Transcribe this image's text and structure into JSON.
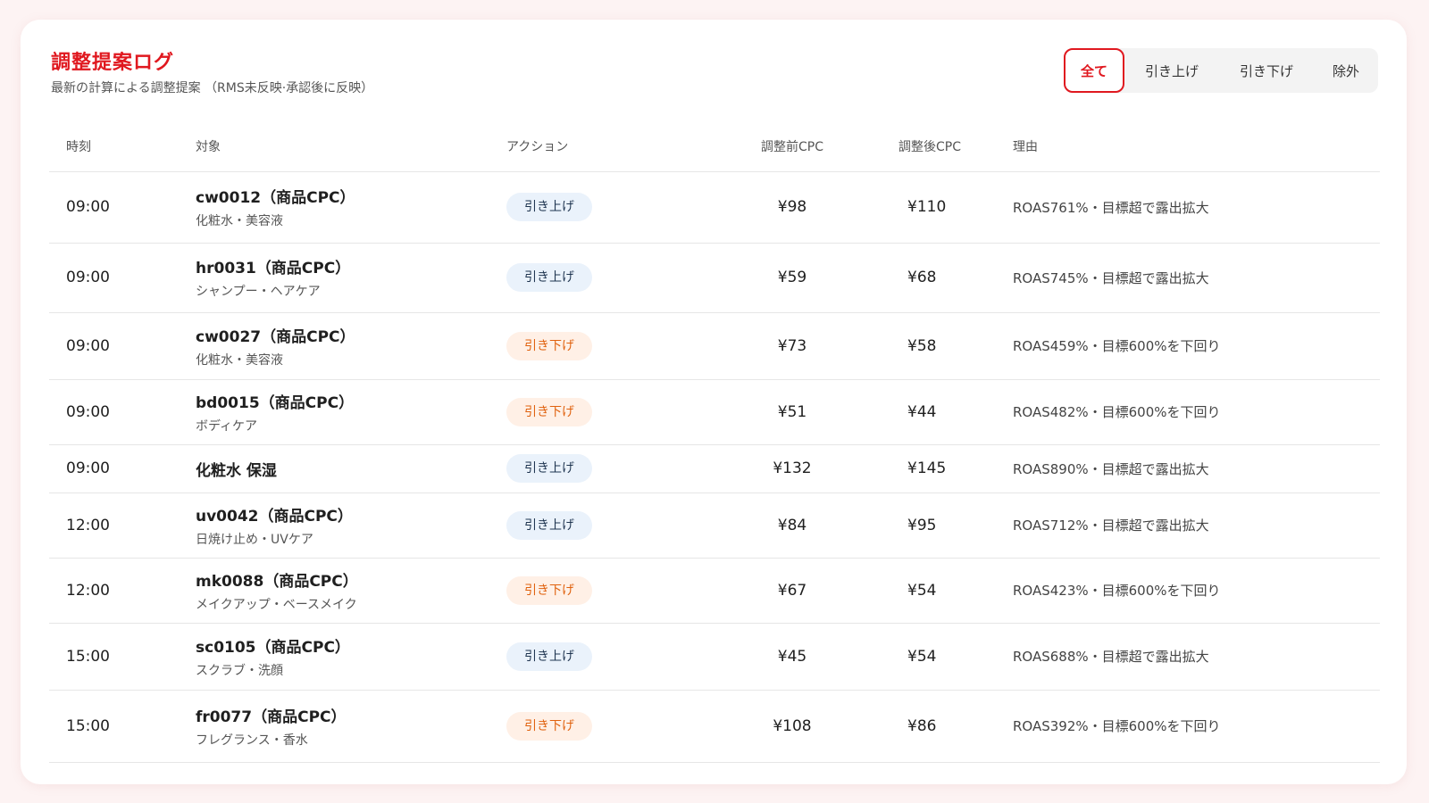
{
  "header": {
    "title": "調整提案ログ",
    "subtitle": "最新の計算による調整提案 （RMS未反映·承認後に反映）"
  },
  "filters": [
    {
      "label": "全て",
      "active": true
    },
    {
      "label": "引き上げ",
      "active": false
    },
    {
      "label": "引き下げ",
      "active": false
    },
    {
      "label": "除外",
      "active": false
    }
  ],
  "table": {
    "columns": {
      "time": "時刻",
      "target": "対象",
      "action": "アクション",
      "before": "調整前CPC",
      "after": "調整後CPC",
      "reason": "理由"
    },
    "rows": [
      {
        "time": "09:00",
        "name": "cw0012（商品CPC）",
        "sub": "化粧水・美容液",
        "action": "引き上げ",
        "type": "up",
        "before": "¥98",
        "after": "¥110",
        "reason": "ROAS761%・目標超で露出拡大"
      },
      {
        "time": "09:00",
        "name": "hr0031（商品CPC）",
        "sub": "シャンプー・ヘアケア",
        "action": "引き上げ",
        "type": "up",
        "before": "¥59",
        "after": "¥68",
        "reason": "ROAS745%・目標超で露出拡大"
      },
      {
        "time": "09:00",
        "name": "cw0027（商品CPC）",
        "sub": "化粧水・美容液",
        "action": "引き下げ",
        "type": "down",
        "before": "¥73",
        "after": "¥58",
        "reason": "ROAS459%・目標600%を下回り"
      },
      {
        "time": "09:00",
        "name": "bd0015（商品CPC）",
        "sub": "ボディケア",
        "action": "引き下げ",
        "type": "down",
        "before": "¥51",
        "after": "¥44",
        "reason": "ROAS482%・目標600%を下回り"
      },
      {
        "time": "09:00",
        "name": "化粧水 保湿",
        "sub": "",
        "action": "引き上げ",
        "type": "up",
        "before": "¥132",
        "after": "¥145",
        "reason": "ROAS890%・目標超で露出拡大"
      },
      {
        "time": "12:00",
        "name": "uv0042（商品CPC）",
        "sub": "日焼け止め・UVケア",
        "action": "引き上げ",
        "type": "up",
        "before": "¥84",
        "after": "¥95",
        "reason": "ROAS712%・目標超で露出拡大"
      },
      {
        "time": "12:00",
        "name": "mk0088（商品CPC）",
        "sub": "メイクアップ・ベースメイク",
        "action": "引き下げ",
        "type": "down",
        "before": "¥67",
        "after": "¥54",
        "reason": "ROAS423%・目標600%を下回り"
      },
      {
        "time": "15:00",
        "name": "sc0105（商品CPC）",
        "sub": "スクラブ・洗顔",
        "action": "引き上げ",
        "type": "up",
        "before": "¥45",
        "after": "¥54",
        "reason": "ROAS688%・目標超で露出拡大"
      },
      {
        "time": "15:00",
        "name": "fr0077（商品CPC）",
        "sub": "フレグランス・香水",
        "action": "引き下げ",
        "type": "down",
        "before": "¥108",
        "after": "¥86",
        "reason": "ROAS392%・目標600%を下回り"
      }
    ]
  },
  "colors": {
    "accent": "#e0181f",
    "up_badge_bg": "#eaf2fb",
    "down_badge_bg": "#fff0e6",
    "down_text": "#e0620f"
  }
}
